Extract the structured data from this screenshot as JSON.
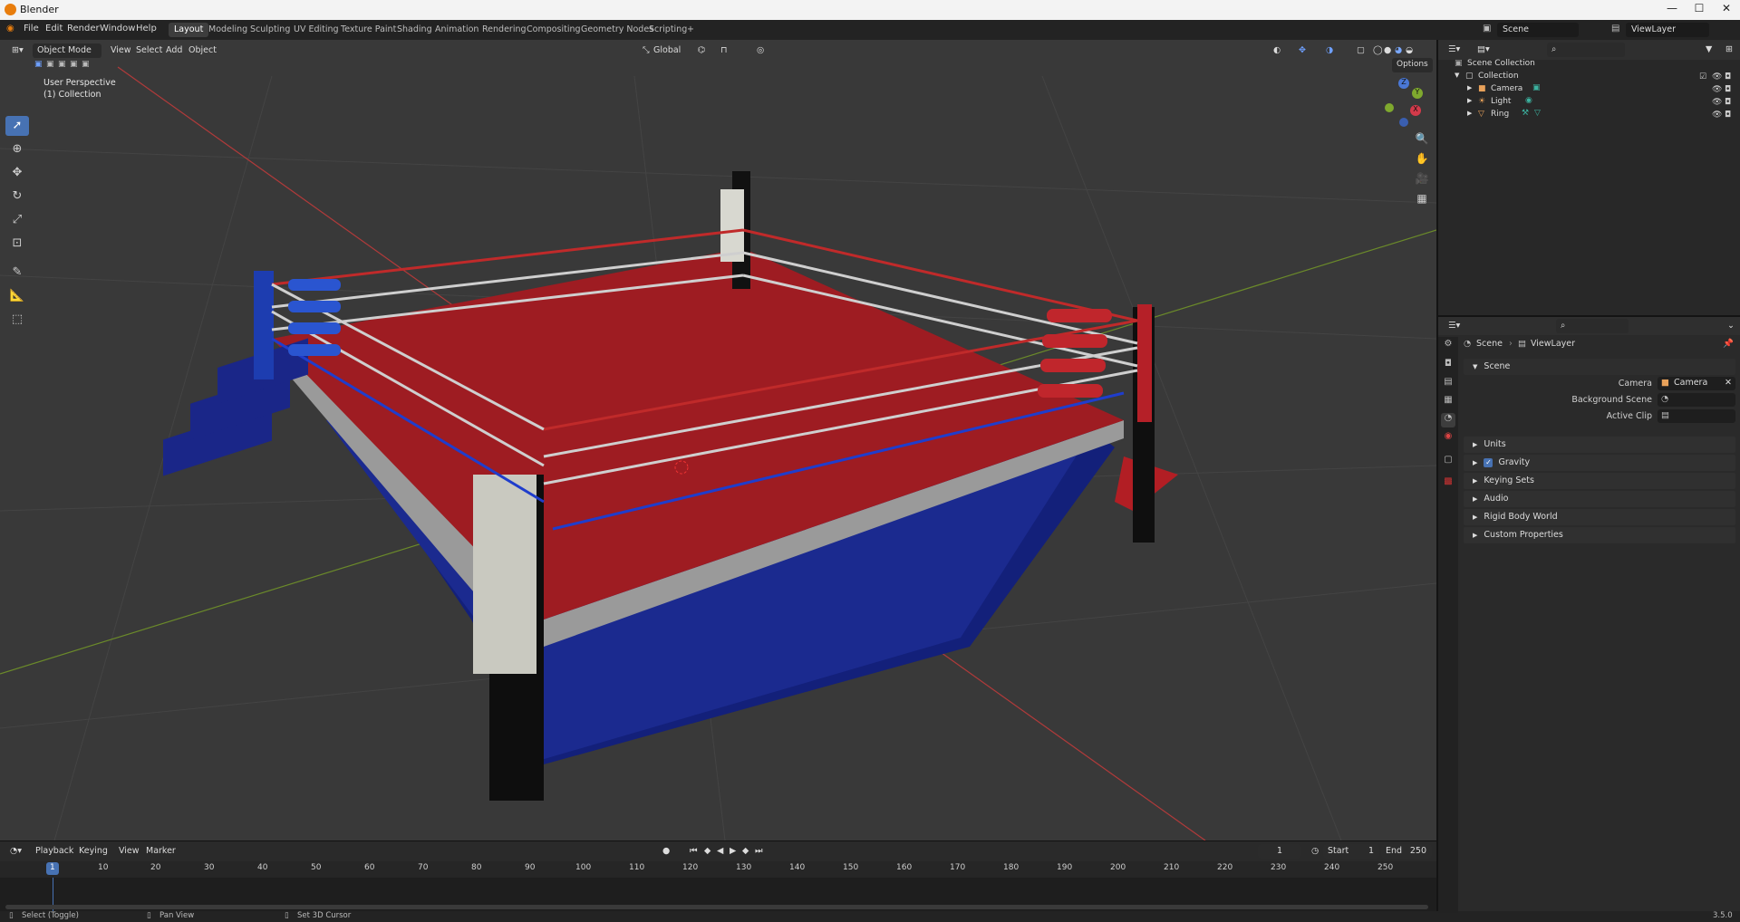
{
  "window": {
    "title": "Blender"
  },
  "menu": {
    "items": [
      "File",
      "Edit",
      "Render",
      "Window",
      "Help"
    ],
    "workspaces": [
      "Layout",
      "Modeling",
      "Sculpting",
      "UV Editing",
      "Texture Paint",
      "Shading",
      "Animation",
      "Rendering",
      "Compositing",
      "Geometry Nodes",
      "Scripting"
    ],
    "active_workspace": "Layout",
    "add_tab": "+",
    "scene": "Scene",
    "view_layer": "ViewLayer"
  },
  "viewport": {
    "mode": "Object Mode",
    "menus": [
      "View",
      "Select",
      "Add",
      "Object"
    ],
    "transform_orientation": "Global",
    "options_label": "Options",
    "info_line1": "User Perspective",
    "info_line2": "(1) Collection",
    "gizmo_axes": [
      "X",
      "Y",
      "Z"
    ]
  },
  "outliner": {
    "root": "Scene Collection",
    "collection": "Collection",
    "objects": [
      "Camera",
      "Light",
      "Ring"
    ]
  },
  "properties": {
    "breadcrumb_scene": "Scene",
    "breadcrumb_layer": "ViewLayer",
    "panel_title": "Scene",
    "camera_label": "Camera",
    "camera_value": "Camera",
    "background_scene_label": "Background Scene",
    "active_clip_label": "Active Clip",
    "subpanels": [
      "Units",
      "Gravity",
      "Keying Sets",
      "Audio",
      "Rigid Body World",
      "Custom Properties"
    ],
    "gravity_checked": true
  },
  "timeline": {
    "menus": [
      "Playback",
      "Keying",
      "View",
      "Marker"
    ],
    "current_frame": "1",
    "start_label": "Start",
    "start": "1",
    "end_label": "End",
    "end": "250",
    "ticks": [
      "1",
      "10",
      "20",
      "30",
      "40",
      "50",
      "60",
      "70",
      "80",
      "90",
      "100",
      "110",
      "120",
      "130",
      "140",
      "150",
      "160",
      "170",
      "180",
      "190",
      "200",
      "210",
      "220",
      "230",
      "240",
      "250"
    ]
  },
  "statusbar": {
    "select": "Select (Toggle)",
    "pan": "Pan View",
    "cursor": "Set 3D Cursor",
    "version": "3.5.0"
  }
}
